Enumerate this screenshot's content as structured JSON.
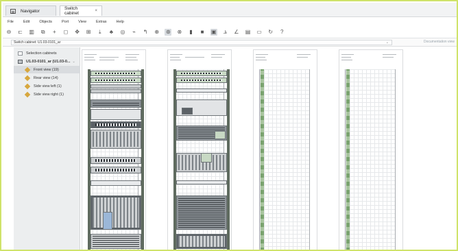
{
  "tabs": [
    {
      "label": "Navigator"
    },
    {
      "label": "Switch cabinet",
      "close": "×"
    }
  ],
  "menu": [
    "File",
    "Edit",
    "Objects",
    "Port",
    "View",
    "Extras",
    "Help"
  ],
  "toolbar": {
    "icons": [
      "back-icon",
      "frame-icon",
      "delete-icon",
      "copy-icon",
      "add-icon",
      "select-icon",
      "move-icon",
      "grid-icon",
      "export-icon",
      "stamp-icon",
      "target-icon",
      "ruler-icon",
      "undo-icon",
      "zoom-in-icon",
      "zoom-fit-icon",
      "zoom-out-icon",
      "fill-icon",
      "dark-view-icon",
      "view-icon",
      "chart-icon",
      "pen-icon",
      "print-icon",
      "window-icon",
      "refresh-icon",
      "help-icon"
    ],
    "active": [
      "zoom-fit-icon",
      "view-icon"
    ]
  },
  "breadcrumb": {
    "value": "Switch cabinet: U1.03-0101_ar",
    "chevron": "⌄",
    "doc_view": "Documentation view"
  },
  "sidebar": {
    "header": "Selection cabinets",
    "cabinet": "U1.03-0101_ar (U1.03-0...",
    "items": [
      {
        "label": "Front view (19)",
        "selected": true
      },
      {
        "label": "Rear view (14)",
        "selected": false
      },
      {
        "label": "Side view left (1)",
        "selected": false
      },
      {
        "label": "Side view right (1)",
        "selected": false
      }
    ]
  }
}
